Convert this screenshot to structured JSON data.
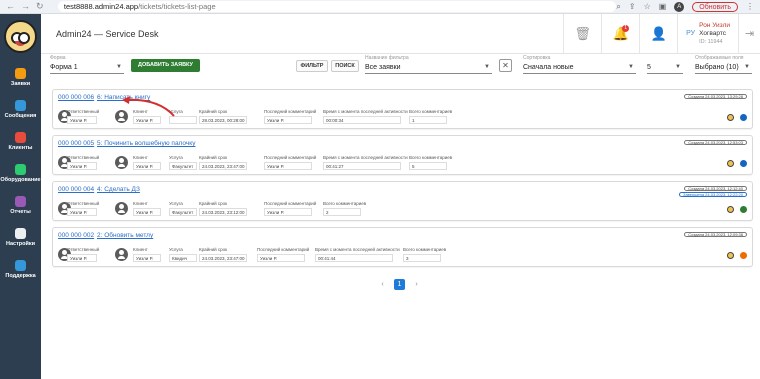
{
  "browser": {
    "url_host": "test8888.admin24.app",
    "url_path": "/tickets/tickets-list-page",
    "profile_initial": "A",
    "update_label": "Обновить"
  },
  "sidebar": {
    "items": [
      {
        "label": "Заявки",
        "icon": "megaphone-icon",
        "color": "#f39c12"
      },
      {
        "label": "Сообщения",
        "icon": "chat-icon",
        "color": "#3498db"
      },
      {
        "label": "Клиенты",
        "icon": "people-icon",
        "color": "#e74c3c"
      },
      {
        "label": "Оборудование",
        "icon": "devices-icon",
        "color": "#2ecc71"
      },
      {
        "label": "Отчеты",
        "icon": "report-icon",
        "color": "#9b59b6"
      },
      {
        "label": "Настройки",
        "icon": "gear-icon",
        "color": "#ecf0f1"
      },
      {
        "label": "Поддержка",
        "icon": "help-icon",
        "color": "#3498db"
      }
    ]
  },
  "header": {
    "title": "Admin24 — Service Desk",
    "notification_count": "1",
    "user": {
      "initials": "РУ",
      "name": "Рон Уизли",
      "org": "Хогвартс",
      "id": "ID: 11944"
    }
  },
  "filters": {
    "form_label": "Форма",
    "form_value": "Форма 1",
    "add_button": "ДОБАВИТЬ ЗАЯВКУ",
    "filter_button": "ФИЛЬТР",
    "search_button": "ПОИСК",
    "filter_name_label": "Название фильтра",
    "filter_name_value": "Все заявки",
    "sort_label": "Сортировка",
    "sort_value": "Сначала новые",
    "page_size_value": "5",
    "fields_label": "Отображаемые поля",
    "fields_value": "Выбрано (10)"
  },
  "labels": {
    "responsible": "Ответственный",
    "client": "Клиент",
    "service": "Услуга",
    "deadline": "Крайний срок",
    "last_comment": "Последний комментарий",
    "since_activity": "Время с момента последней активности",
    "total_comments": "Всего комментариев"
  },
  "tickets": [
    {
      "number": "000 000 006",
      "title": "6: Написать книгу",
      "responsible": "Уизли Р.",
      "client": "Уизли Р.",
      "service": "",
      "deadline": "28.03.2023, 00:28:00",
      "last_comment": "Уизли Р.",
      "since_activity": "00:00:34",
      "total_comments": "1",
      "stamps": [
        "Создана 24.03.2023, 13:29:28"
      ],
      "status_color": "#1565c0"
    },
    {
      "number": "000 000 005",
      "title": "5: Починить волшебную палочку",
      "responsible": "Уизли Р.",
      "client": "Уизли Р.",
      "service": "Факультет",
      "deadline": "24.03.2023, 23:47:00",
      "last_comment": "Уизли Р.",
      "since_activity": "00:41:27",
      "total_comments": "5",
      "stamps": [
        "Создана 24.03.2023, 12:53:03"
      ],
      "status_color": "#1565c0"
    },
    {
      "number": "000 000 004",
      "title": "4: Сделать ДЗ",
      "responsible": "Уизли Р.",
      "client": "Уизли Р.",
      "service": "Факультет",
      "deadline": "24.03.2023, 23:12:00",
      "last_comment": "Уизли Р.",
      "since_activity": "",
      "total_comments": "2",
      "stamps": [
        "Создана 24.03.2023, 12:12:40",
        "Завершена 24.03.2023, 12:22:20"
      ],
      "status_color": "#2e7d32"
    },
    {
      "number": "000 000 002",
      "title": "2: Обновить метлу",
      "responsible": "Уизли Р.",
      "client": "Уизли Р.",
      "service": "Квидич",
      "deadline": "24.03.2023, 23:47:00",
      "last_comment": "Уизли Р.",
      "since_activity": "00:41:44",
      "total_comments": "3",
      "stamps": [
        "Создана 24.03.2023, 12:09:38"
      ],
      "status_color": "#ef6c00"
    }
  ],
  "pagination": {
    "prev": "‹",
    "current": "1",
    "next": "›"
  }
}
